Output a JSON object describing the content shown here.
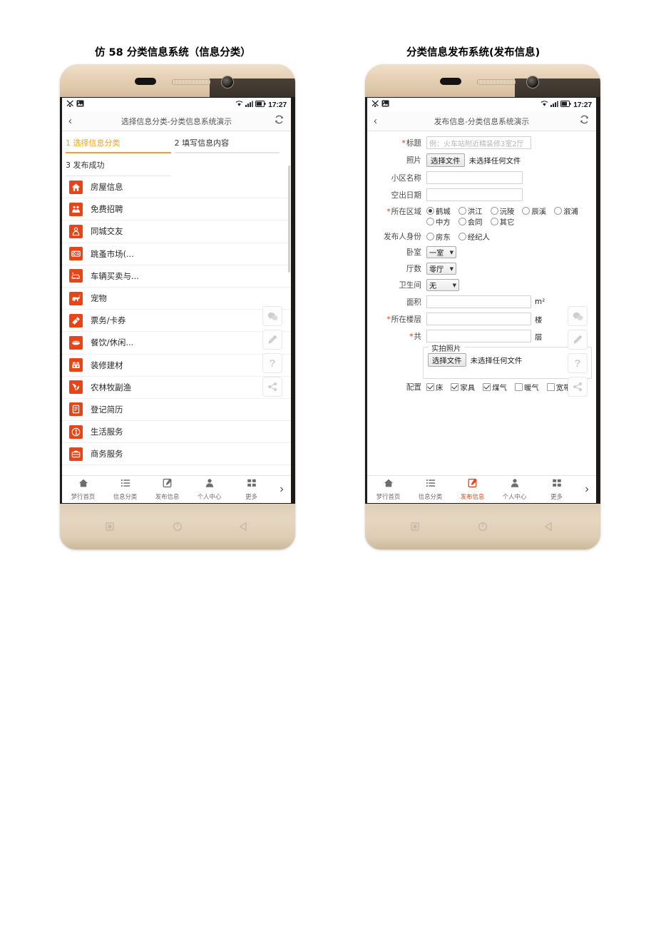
{
  "captions": {
    "left": "仿 58 分类信息系统（信息分类）",
    "right": "分类信息发布系统(发布信息)"
  },
  "status_bar": {
    "time": "17:27",
    "icons": [
      "mute-icon",
      "image-icon",
      "wifi-icon",
      "signal-icon",
      "battery-icon"
    ]
  },
  "left_phone": {
    "titlebar": {
      "back": "‹",
      "title": "选择信息分类-分类信息系统演示",
      "refresh_icon": "refresh-icon"
    },
    "steps": [
      {
        "label": "1 选择信息分类",
        "active": true
      },
      {
        "label": "2 填写信息内容",
        "active": false
      },
      {
        "label": "3 发布成功",
        "active": false
      }
    ],
    "categories": [
      {
        "label": "房屋信息",
        "icon": "house-icon"
      },
      {
        "label": "免费招聘",
        "icon": "recruit-icon"
      },
      {
        "label": "同城交友",
        "icon": "friends-icon"
      },
      {
        "label": "跳蚤市场(...",
        "icon": "flea-market-icon"
      },
      {
        "label": "车辆买卖与...",
        "icon": "car-icon"
      },
      {
        "label": "宠物",
        "icon": "pet-icon"
      },
      {
        "label": "票务/卡券",
        "icon": "ticket-icon"
      },
      {
        "label": "餐饮/休闲...",
        "icon": "food-icon"
      },
      {
        "label": "装修建材",
        "icon": "decoration-icon"
      },
      {
        "label": "农林牧副渔",
        "icon": "agriculture-icon"
      },
      {
        "label": "登记简历",
        "icon": "resume-icon"
      },
      {
        "label": "生活服务",
        "icon": "life-service-icon"
      },
      {
        "label": "商务服务",
        "icon": "business-service-icon"
      }
    ],
    "float_buttons": [
      {
        "icon": "wechat-icon"
      },
      {
        "icon": "pencil-icon"
      },
      {
        "icon": "question-icon",
        "label": "?"
      },
      {
        "icon": "share-icon"
      }
    ],
    "tabbar": [
      {
        "label": "梦行首页",
        "icon": "home-icon",
        "active": false
      },
      {
        "label": "信息分类",
        "icon": "list-icon",
        "active": false
      },
      {
        "label": "发布信息",
        "icon": "compose-icon",
        "active": false
      },
      {
        "label": "个人中心",
        "icon": "user-icon",
        "active": false
      },
      {
        "label": "更多",
        "icon": "grid-icon",
        "active": false
      }
    ],
    "tab_more_arrow": "›"
  },
  "right_phone": {
    "titlebar": {
      "back": "‹",
      "title": "发布信息-分类信息系统演示",
      "refresh_icon": "refresh-icon"
    },
    "form": {
      "title_row": {
        "label": "标题",
        "required": true,
        "placeholder": "例：火车站附近精装修3室2厅",
        "value": ""
      },
      "photo_row": {
        "label": "照片",
        "required": false,
        "button": "选择文件",
        "status": "未选择任何文件"
      },
      "community_row": {
        "label": "小区名称",
        "required": false,
        "value": ""
      },
      "vacancy_row": {
        "label": "空出日期",
        "required": false,
        "value": ""
      },
      "region_row": {
        "label": "所在区域",
        "required": true,
        "options": [
          {
            "label": "鹤城",
            "selected": true
          },
          {
            "label": "洪江",
            "selected": false
          },
          {
            "label": "沅陵",
            "selected": false
          },
          {
            "label": "辰溪",
            "selected": false
          },
          {
            "label": "溆浦",
            "selected": false
          },
          {
            "label": "中方",
            "selected": false
          },
          {
            "label": "会同",
            "selected": false
          },
          {
            "label": "其它",
            "selected": false
          }
        ]
      },
      "identity_row": {
        "label": "发布人身份",
        "required": false,
        "options": [
          {
            "label": "房东",
            "selected": false
          },
          {
            "label": "经纪人",
            "selected": false
          }
        ]
      },
      "bedroom_row": {
        "label": "卧室",
        "required": false,
        "value": "一室"
      },
      "living_row": {
        "label": "厅数",
        "required": false,
        "value": "零厅"
      },
      "bath_row": {
        "label": "卫生间",
        "required": false,
        "value": "无"
      },
      "area_row": {
        "label": "面积",
        "required": false,
        "value": "",
        "unit": "m²"
      },
      "floor_row": {
        "label": "所在楼层",
        "required": true,
        "value": "",
        "unit": "楼"
      },
      "total_floor_row": {
        "label": "共",
        "required": true,
        "value": "",
        "unit": "层"
      },
      "real_photo": {
        "legend": "实拍照片",
        "button": "选择文件",
        "status": "未选择任何文件"
      },
      "config_row": {
        "label": "配置",
        "items": [
          {
            "label": "床",
            "checked": true
          },
          {
            "label": "家具",
            "checked": true
          },
          {
            "label": "煤气",
            "checked": true
          },
          {
            "label": "暖气",
            "checked": false
          },
          {
            "label": "宽带",
            "checked": false
          },
          {
            "label": "",
            "checked": false
          }
        ]
      }
    },
    "float_buttons": [
      {
        "icon": "wechat-icon"
      },
      {
        "icon": "pencil-icon"
      },
      {
        "icon": "question-icon",
        "label": "?"
      },
      {
        "icon": "share-icon"
      }
    ],
    "tabbar": [
      {
        "label": "梦行首页",
        "icon": "home-icon",
        "active": false
      },
      {
        "label": "信息分类",
        "icon": "list-icon",
        "active": false
      },
      {
        "label": "发布信息",
        "icon": "compose-icon",
        "active": true
      },
      {
        "label": "个人中心",
        "icon": "user-icon",
        "active": false
      },
      {
        "label": "更多",
        "icon": "grid-icon",
        "active": false
      }
    ],
    "tab_more_arrow": "›"
  },
  "colors": {
    "accent_orange": "#f5a418",
    "icon_red": "#ea4316",
    "required_red": "#e03a18",
    "bezel_gold": "#ded0bb"
  }
}
